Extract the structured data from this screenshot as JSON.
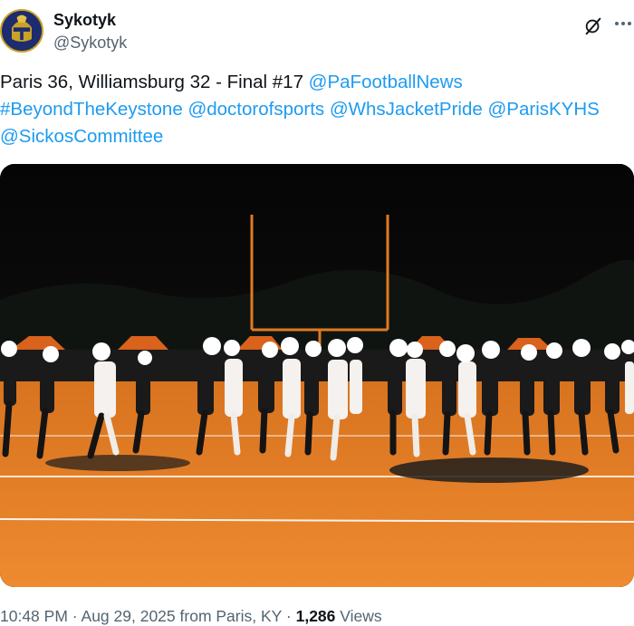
{
  "author": {
    "name": "Sykotyk",
    "handle": "@Sykotyk",
    "avatar_icon": "trojan-helmet-logo-icon"
  },
  "tweet": {
    "line1_text": "Paris 36, Williamsburg 32 - Final #17 ",
    "line1_mention": "@PaFootballNews",
    "line2_hashtag": "#BeyondTheKeystone",
    "line2_mentions": [
      "@doctorofsports",
      "@WhsJacketPride",
      "@ParisKYHS"
    ],
    "line3_mention": "@SickosCommittee"
  },
  "media": {
    "description_icon": "football-handshake-photo"
  },
  "meta": {
    "time": "10:48 PM",
    "date": "Aug 29, 2025",
    "location": "from Paris, KY",
    "separator": "·",
    "views_count": "1,286",
    "views_label": "Views"
  },
  "icons": {
    "grok": "grok-icon",
    "more": "more-icon"
  },
  "colors": {
    "link": "#1d9bf0",
    "muted": "#536471",
    "text": "#0f1419",
    "field_orange": "#e9822a"
  }
}
